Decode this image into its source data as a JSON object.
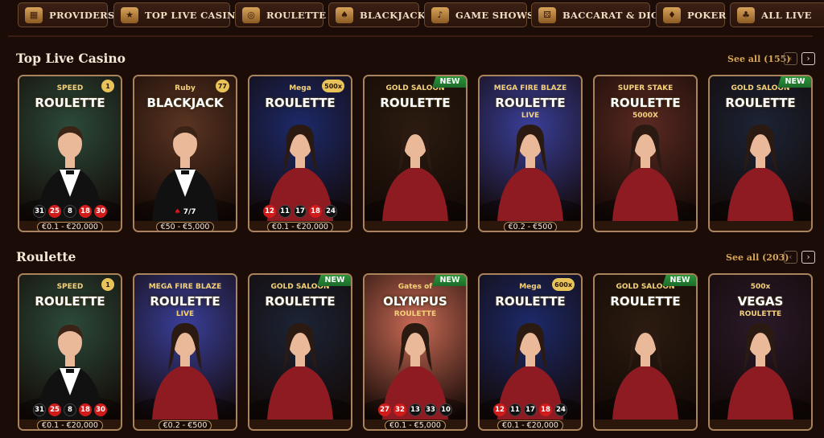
{
  "nav": [
    {
      "label": "PROVIDERS",
      "icon": "providers-icon",
      "glyph": "▦"
    },
    {
      "label": "TOP LIVE CASINO",
      "icon": "top-live-casino-icon",
      "glyph": "★"
    },
    {
      "label": "ROULETTE",
      "icon": "roulette-wheel-icon",
      "glyph": "◎"
    },
    {
      "label": "BLACKJACK",
      "icon": "playing-cards-icon",
      "glyph": "♠"
    },
    {
      "label": "GAME SHOWS",
      "icon": "microphone-icon",
      "glyph": "♪"
    },
    {
      "label": "BACCARAT & DICE",
      "icon": "dice-icon",
      "glyph": "⚄"
    },
    {
      "label": "POKER",
      "icon": "poker-chip-icon",
      "glyph": "♦"
    },
    {
      "label": "ALL LIVE",
      "icon": "all-live-icon",
      "glyph": "♣"
    }
  ],
  "sections": [
    {
      "title": "Top Live Casino",
      "see_all": "See all (155)",
      "cards": [
        {
          "logo_top": "SPEED",
          "logo": "ROULETTE",
          "badge": "1",
          "limit": "€0.1 - €20,000",
          "bg": "#2c4a3a",
          "dealer": "m",
          "results": [
            [
              "31",
              "black"
            ],
            [
              "25",
              "red"
            ],
            [
              "8",
              "black"
            ],
            [
              "18",
              "red"
            ],
            [
              "30",
              "red"
            ]
          ]
        },
        {
          "logo_top": "Ruby",
          "logo": "BLACKJACK",
          "badge": "77",
          "limit": "€50 - €5,000",
          "bg": "#5a3422",
          "dealer": "m",
          "bj": "7/7"
        },
        {
          "logo_top": "Mega",
          "logo": "ROULETTE",
          "badge": "500x",
          "limit": "€0.1 - €20,000",
          "bg": "#1d2a6a",
          "dealer": "f",
          "results": [
            [
              "12",
              "red"
            ],
            [
              "11",
              "black"
            ],
            [
              "17",
              "black"
            ],
            [
              "18",
              "red"
            ],
            [
              "24",
              "black"
            ]
          ]
        },
        {
          "logo_top": "GOLD SALOON",
          "logo": "ROULETTE",
          "new": "NEW",
          "limit": "",
          "bg": "#2b1c10",
          "dealer": "f"
        },
        {
          "logo_top": "MEGA FIRE BLAZE",
          "logo": "ROULETTE",
          "logo_sub": "LIVE",
          "limit": "€0.2 - €500",
          "bg": "#3a3f9a",
          "dealer": "f"
        },
        {
          "logo_top": "SUPER STAKE",
          "logo": "ROULETTE",
          "logo_sub": "5000X",
          "limit": "",
          "bg": "#5a2a22",
          "dealer": "f"
        },
        {
          "logo_top": "GOLD SALOON",
          "logo": "ROULETTE",
          "new": "NEW",
          "limit": "",
          "bg": "#1c2436",
          "dealer": "f"
        }
      ]
    },
    {
      "title": "Roulette",
      "see_all": "See all (203)",
      "cards": [
        {
          "logo_top": "SPEED",
          "logo": "ROULETTE",
          "badge": "1",
          "limit": "€0.1 - €20,000",
          "bg": "#2c4a3a",
          "dealer": "m",
          "results": [
            [
              "31",
              "black"
            ],
            [
              "25",
              "red"
            ],
            [
              "8",
              "black"
            ],
            [
              "18",
              "red"
            ],
            [
              "30",
              "red"
            ]
          ]
        },
        {
          "logo_top": "MEGA FIRE BLAZE",
          "logo": "ROULETTE",
          "logo_sub": "LIVE",
          "limit": "€0.2 - €500",
          "bg": "#3a3f9a",
          "dealer": "f"
        },
        {
          "logo_top": "GOLD SALOON",
          "logo": "ROULETTE",
          "new": "NEW",
          "limit": "",
          "bg": "#1c2436",
          "dealer": "f"
        },
        {
          "logo_top": "Gates of",
          "logo": "OLYMPUS",
          "logo_sub": "ROULETTE",
          "new": "NEW",
          "limit": "€0.1 - €5,000",
          "bg": "#c96a55",
          "dealer": "f",
          "results": [
            [
              "27",
              "red"
            ],
            [
              "32",
              "red"
            ],
            [
              "13",
              "black"
            ],
            [
              "33",
              "black"
            ],
            [
              "10",
              "black"
            ]
          ]
        },
        {
          "logo_top": "Mega",
          "logo": "ROULETTE",
          "badge": "600x",
          "limit": "€0.1 - €20,000",
          "bg": "#1d2a6a",
          "dealer": "f",
          "results": [
            [
              "12",
              "red"
            ],
            [
              "11",
              "black"
            ],
            [
              "17",
              "black"
            ],
            [
              "18",
              "red"
            ],
            [
              "24",
              "black"
            ]
          ]
        },
        {
          "logo_top": "GOLD SALOON",
          "logo": "ROULETTE",
          "new": "NEW",
          "limit": "",
          "bg": "#2b1c10",
          "dealer": "f"
        },
        {
          "logo_top": "500x",
          "logo": "VEGAS",
          "logo_sub": "ROULETTE",
          "limit": "",
          "bg": "#2a1a2a",
          "dealer": "f"
        }
      ]
    }
  ]
}
